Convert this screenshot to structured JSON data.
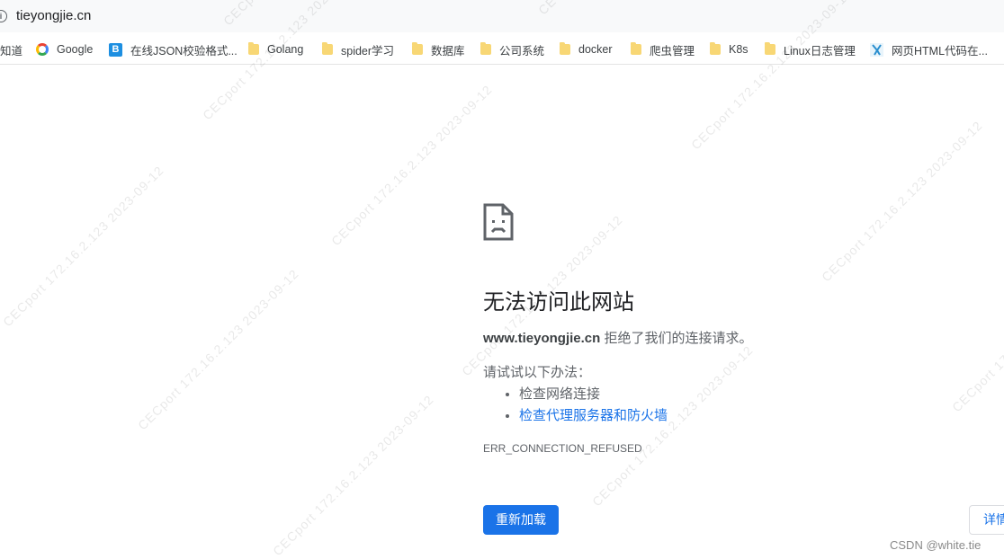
{
  "address_bar": {
    "url": "tieyongjie.cn",
    "info_icon": "info-icon"
  },
  "bookmarks": [
    {
      "label": "知道",
      "icon": "page-icon"
    },
    {
      "label": "Google",
      "icon": "google-icon"
    },
    {
      "label": "在线JSON校验格式...",
      "icon": "json-icon"
    },
    {
      "label": "Golang",
      "icon": "folder-icon"
    },
    {
      "label": "spider学习",
      "icon": "folder-icon"
    },
    {
      "label": "数据库",
      "icon": "folder-icon"
    },
    {
      "label": "公司系统",
      "icon": "folder-icon"
    },
    {
      "label": "docker",
      "icon": "folder-icon"
    },
    {
      "label": "爬虫管理",
      "icon": "folder-icon"
    },
    {
      "label": "K8s",
      "icon": "folder-icon"
    },
    {
      "label": "Linux日志管理",
      "icon": "folder-icon"
    },
    {
      "label": "网页HTML代码在...",
      "icon": "html-tool-icon"
    }
  ],
  "error_page": {
    "icon": "sad-document-icon",
    "title": "无法访问此网站",
    "host": "www.tieyongjie.cn",
    "message_suffix": " 拒绝了我们的连接请求。",
    "try_heading": "请试试以下办法：",
    "suggestions": [
      "检查网络连接",
      "检查代理服务器和防火墙"
    ],
    "error_code": "ERR_CONNECTION_REFUSED",
    "reload_label": "重新加载",
    "details_label": "详情"
  },
  "watermark": "CECport 172.16.2.123 2023-09-12",
  "credit": "CSDN @white.tie",
  "colors": {
    "accent": "#1a73e8",
    "folder": "#f8d775",
    "text_secondary": "#5f6368"
  }
}
